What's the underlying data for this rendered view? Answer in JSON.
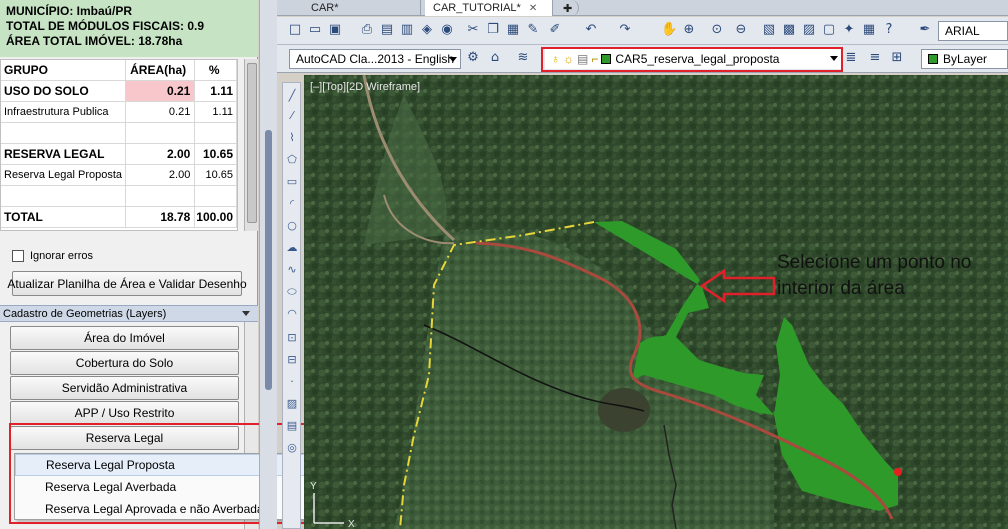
{
  "info": {
    "municipio": "MUNICÍPIO: Imbaú/PR",
    "modulos": "TOTAL DE MÓDULOS FISCAIS: 0.9",
    "area_total": "ÁREA TOTAL IMÓVEL: 18.78ha"
  },
  "table": {
    "headers": [
      "GRUPO",
      "ÁREA(ha)",
      "%"
    ],
    "rows": [
      {
        "grupo": "USO DO SOLO",
        "area": "0.21",
        "pct": "1.11"
      },
      {
        "grupo": "Infraestrutura Publica",
        "area": "0.21",
        "pct": "1.11"
      },
      {
        "grupo": "",
        "area": "",
        "pct": ""
      },
      {
        "grupo": "RESERVA LEGAL",
        "area": "2.00",
        "pct": "10.65"
      },
      {
        "grupo": "Reserva Legal Proposta",
        "area": "2.00",
        "pct": "10.65"
      },
      {
        "grupo": "",
        "area": "",
        "pct": ""
      },
      {
        "grupo": "TOTAL",
        "area": "18.78",
        "pct": "100.00"
      }
    ]
  },
  "ignorar_erros": "Ignorar erros",
  "atualizar_button": "Atualizar Planilha de Área e Validar Desenho",
  "cadastro_header": "Cadastro de Geometrias (Layers)",
  "layer_buttons": [
    "Área do Imóvel",
    "Cobertura do Solo",
    "Servidão Administrativa",
    "APP / Uso Restrito",
    "Reserva Legal"
  ],
  "dropdown_items": [
    "Reserva Legal Proposta",
    "Reserva Legal Averbada",
    "Reserva Legal Aprovada e não Averbada"
  ],
  "tabs": [
    "CAR*",
    "CAR_TUTORIAL*"
  ],
  "workspace": "AutoCAD Cla...2013 - English",
  "layer_name": "CAR5_reserva_legal_proposta",
  "bylayer": "ByLayer",
  "font_combo": "ARIAL",
  "viewport_label": "[–][Top][2D Wireframe]",
  "annotation": "Selecione um ponto no interior da área",
  "colors": {
    "info_bg": "#c6e3c4",
    "highlight_pink": "#f8c7cc",
    "polygon_green": "#2e9a2a",
    "boundary_yellow": "#e7d63a",
    "road_red": "#a84a3e",
    "callout_red": "#e0202a"
  }
}
